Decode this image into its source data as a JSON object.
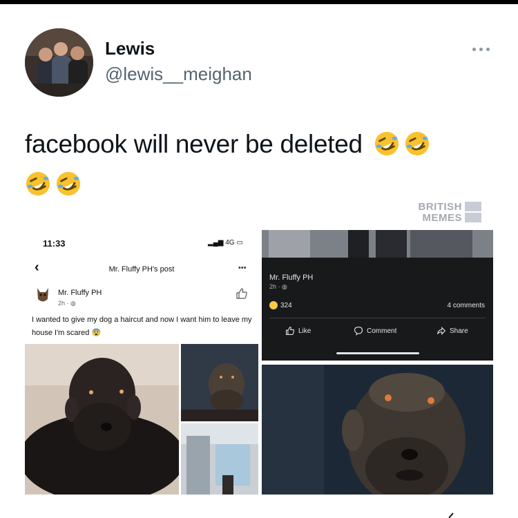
{
  "tweet": {
    "display_name": "Lewis",
    "handle": "@lewis__meighan",
    "text": "facebook will never be deleted",
    "emojis": [
      "rolling-on-floor-laughing-emoji",
      "rolling-on-floor-laughing-emoji",
      "rolling-on-floor-laughing-emoji",
      "rolling-on-floor-laughing-emoji"
    ]
  },
  "watermark": {
    "line1": "BRITISH",
    "line2": "MEMES"
  },
  "fb_left": {
    "status_time": "11:33",
    "network": "4G",
    "header_title": "Mr. Fluffy PH's post",
    "page_name": "Mr. Fluffy PH",
    "time": "2h ·",
    "post_text": "I wanted to give my dog a haircut and now I want him to leave my house I'm scared"
  },
  "fb_right": {
    "page_name": "Mr. Fluffy PH",
    "time": "2h ·",
    "reaction_count": "324",
    "comments": "4 comments",
    "actions": {
      "like": "Like",
      "comment": "Comment",
      "share": "Share"
    }
  },
  "colors": {
    "text": "#0f1419",
    "handle": "#536471",
    "dark_bg": "#18191a"
  }
}
